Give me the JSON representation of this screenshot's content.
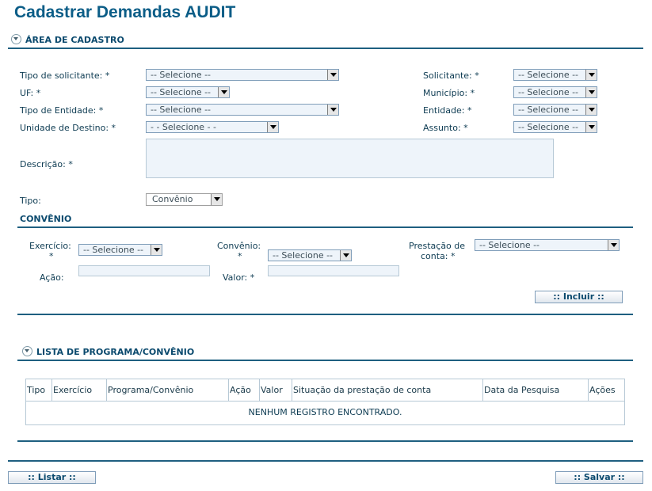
{
  "page": {
    "title": "Cadastrar Demandas AUDIT"
  },
  "cadastro": {
    "section_title": "ÁREA DE CADASTRO",
    "tipo_solicitante": {
      "label": "Tipo de solicitante: *",
      "value": "-- Selecione --"
    },
    "solicitante": {
      "label": "Solicitante: *",
      "value": "-- Selecione --"
    },
    "uf": {
      "label": "UF: *",
      "value": "-- Selecione --"
    },
    "municipio": {
      "label": "Município: *",
      "value": "-- Selecione --"
    },
    "tipo_entidade": {
      "label": "Tipo de Entidade: *",
      "value": "-- Selecione --"
    },
    "entidade": {
      "label": "Entidade: *",
      "value": "-- Selecione --"
    },
    "unidade_destino": {
      "label": "Unidade de Destino: *",
      "value": "- - Selecione - -"
    },
    "assunto": {
      "label": "Assunto: *",
      "value": "-- Selecione --"
    },
    "descricao": {
      "label": "Descrição: *",
      "value": ""
    },
    "tipo": {
      "label": "Tipo:",
      "value": "Convênio"
    }
  },
  "convenio": {
    "section_title": "CONVÊNIO",
    "exercicio": {
      "label1": "Exercício:",
      "label2": "*",
      "value": "-- Selecione --"
    },
    "convenio_field": {
      "label1": "Convênio:",
      "label2": "*",
      "value": "-- Selecione --"
    },
    "prestacao": {
      "label1": "Prestação de",
      "label2": "conta: *",
      "value": "-- Selecione --"
    },
    "acao": {
      "label": "Ação:",
      "value": ""
    },
    "valor": {
      "label": "Valor: *",
      "value": ""
    },
    "incluir_label": ":: Incluir ::"
  },
  "lista": {
    "section_title": "LISTA DE PROGRAMA/CONVÊNIO",
    "columns": [
      "Tipo",
      "Exercício",
      "Programa/Convênio",
      "Ação",
      "Valor",
      "Situação da prestação de conta",
      "Data da Pesquisa",
      "Ações"
    ],
    "empty_message": "NENHUM REGISTRO ENCONTRADO."
  },
  "footer": {
    "listar_label": ":: Listar ::",
    "salvar_label": ":: Salvar ::"
  }
}
